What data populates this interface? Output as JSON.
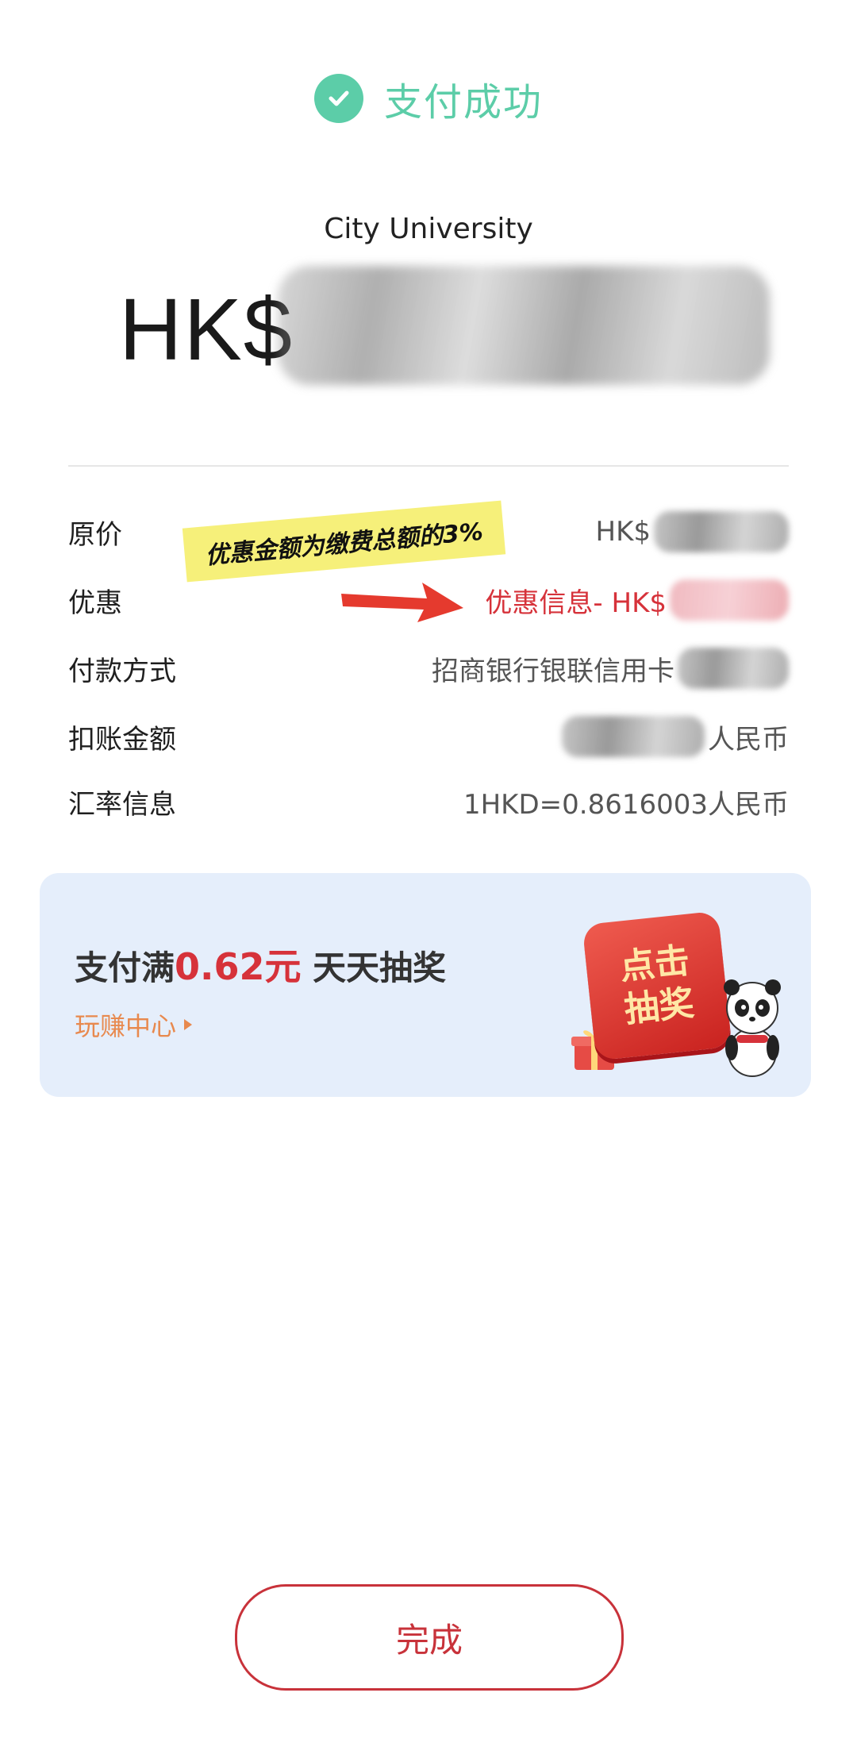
{
  "status": {
    "text": "支付成功",
    "color": "#5ccda8",
    "icon": "checkmark-icon"
  },
  "merchant": {
    "name": "City University"
  },
  "amount": {
    "currency_prefix": "HK$"
  },
  "details": [
    {
      "label": "原价",
      "value": "HK$"
    },
    {
      "label": "优惠",
      "value": "优惠信息- HK$"
    },
    {
      "label": "付款方式",
      "value": "招商银行银联信用卡"
    },
    {
      "label": "扣账金额",
      "value": "人民币"
    },
    {
      "label": "汇率信息",
      "value": "1HKD=0.8616003人民币"
    }
  ],
  "annotation": {
    "text": "优惠金额为缴费总额的3%"
  },
  "promo": {
    "title_prefix": "支付满",
    "title_amount": "0.62元",
    "title_suffix": "天天抽奖",
    "link_text": "玩赚中心",
    "button_line1": "点击",
    "button_line2": "抽奖"
  },
  "done_button": {
    "label": "完成"
  },
  "colors": {
    "accent_green": "#5ccda8",
    "accent_red": "#d6323a",
    "promo_bg": "#e5eefb"
  }
}
